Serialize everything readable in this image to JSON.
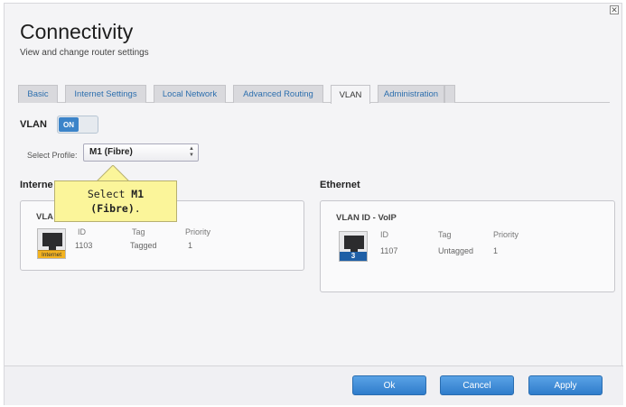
{
  "page": {
    "title": "Connectivity",
    "subtitle": "View and change router settings"
  },
  "tabs": [
    {
      "label": "Basic",
      "active": false
    },
    {
      "label": "Internet Settings",
      "active": false
    },
    {
      "label": "Local Network",
      "active": false
    },
    {
      "label": "Advanced Routing",
      "active": false
    },
    {
      "label": "VLAN",
      "active": true
    },
    {
      "label": "Administration",
      "active": false
    }
  ],
  "vlan": {
    "label": "VLAN",
    "toggle_state": "ON"
  },
  "profile": {
    "label": "Select Profile:",
    "selected": "M1 (Fibre)"
  },
  "callout": {
    "line1_prefix": "Select ",
    "line1_bold": "M1",
    "line2_bold": "(Fibre)",
    "line2_suffix": "."
  },
  "internet": {
    "section_title": "Interne",
    "panel_head": "VLA",
    "col_id": "ID",
    "col_tag": "Tag",
    "col_priority": "Priority",
    "id": "1103",
    "tag": "Tagged",
    "priority": "1",
    "port_label": "Internet"
  },
  "ethernet": {
    "section_title": "Ethernet",
    "panel_head": "VLAN ID - VoIP",
    "col_id": "ID",
    "col_tag": "Tag",
    "col_priority": "Priority",
    "id": "1107",
    "tag": "Untagged",
    "priority": "1",
    "port_label": "3"
  },
  "footer": {
    "ok_label": "Ok",
    "cancel_label": "Cancel",
    "apply_label": "Apply"
  },
  "colors": {
    "accent": "#3c84c9",
    "tab_link": "#2d6fae",
    "callout_bg": "#fbf59a",
    "internet_port": "#f2b21f",
    "ethernet_port": "#1f5fa6"
  }
}
